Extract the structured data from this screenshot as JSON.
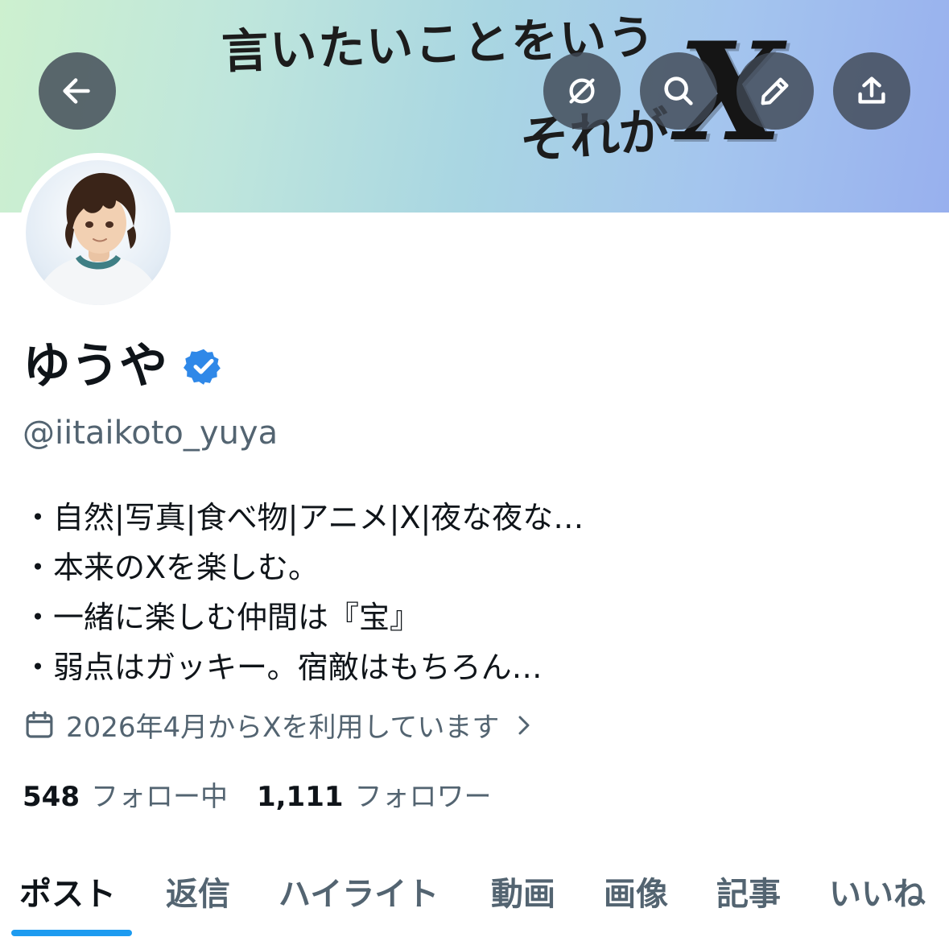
{
  "banner": {
    "line1": "言いたいことをいう",
    "line2": "それが",
    "x_mark": "X"
  },
  "header_buttons": {
    "back": "arrow-left-icon",
    "grok": "grok-icon",
    "search": "search-icon",
    "edit": "pencil-icon",
    "share": "share-icon"
  },
  "profile": {
    "display_name": "ゆうや",
    "verified": true,
    "handle": "@iitaikoto_yuya",
    "bio": [
      "・自然|写真|食べ物|アニメ|X|夜な夜な…",
      "・本来のXを楽しむ。",
      "・一緒に楽しむ仲間は『宝』",
      "・弱点はガッキー。宿敵はもちろん…"
    ],
    "joined": "2026年4月からXを利用しています"
  },
  "stats": {
    "following_count": "548",
    "following_label": "フォロー中",
    "followers_count": "1,111",
    "followers_label": "フォロワー"
  },
  "tabs": [
    "ポスト",
    "返信",
    "ハイライト",
    "動画",
    "画像",
    "記事",
    "いいね"
  ],
  "active_tab": "ポスト",
  "colors": {
    "accent": "#1d9bf0",
    "verified_badge": "#2f88e8",
    "secondary_text": "#536471",
    "primary_text": "#0f1419"
  }
}
